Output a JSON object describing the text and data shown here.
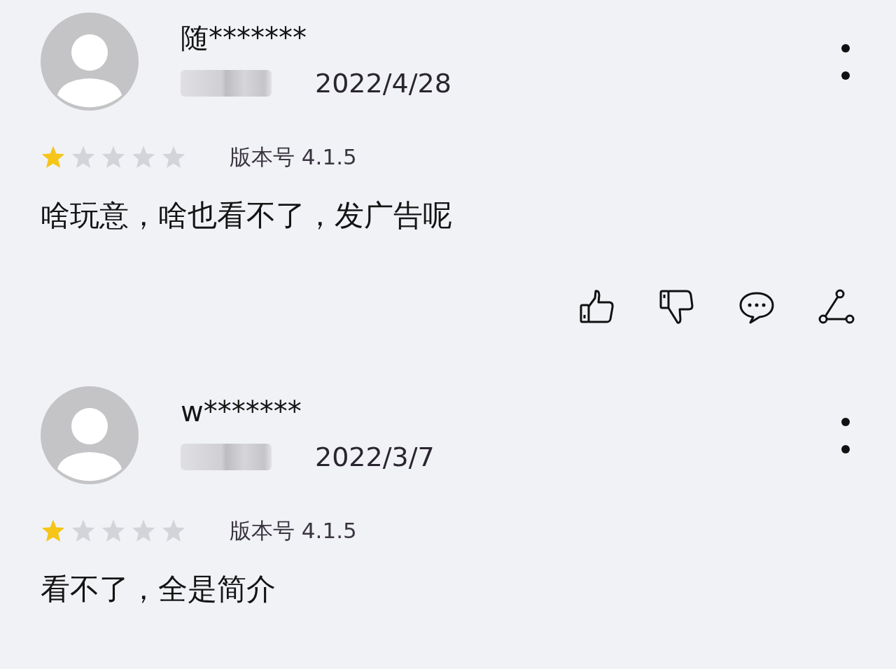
{
  "reviews": [
    {
      "user": "随*******",
      "date": "2022/4/28",
      "stars": 1,
      "version": "版本号 4.1.5",
      "text": "啥玩意，啥也看不了，发广告呢",
      "show_actions": true
    },
    {
      "user": "w*******",
      "date": "2022/3/7",
      "stars": 1,
      "version": "版本号 4.1.5",
      "text": "看不了，全是简介",
      "show_actions": false
    }
  ]
}
